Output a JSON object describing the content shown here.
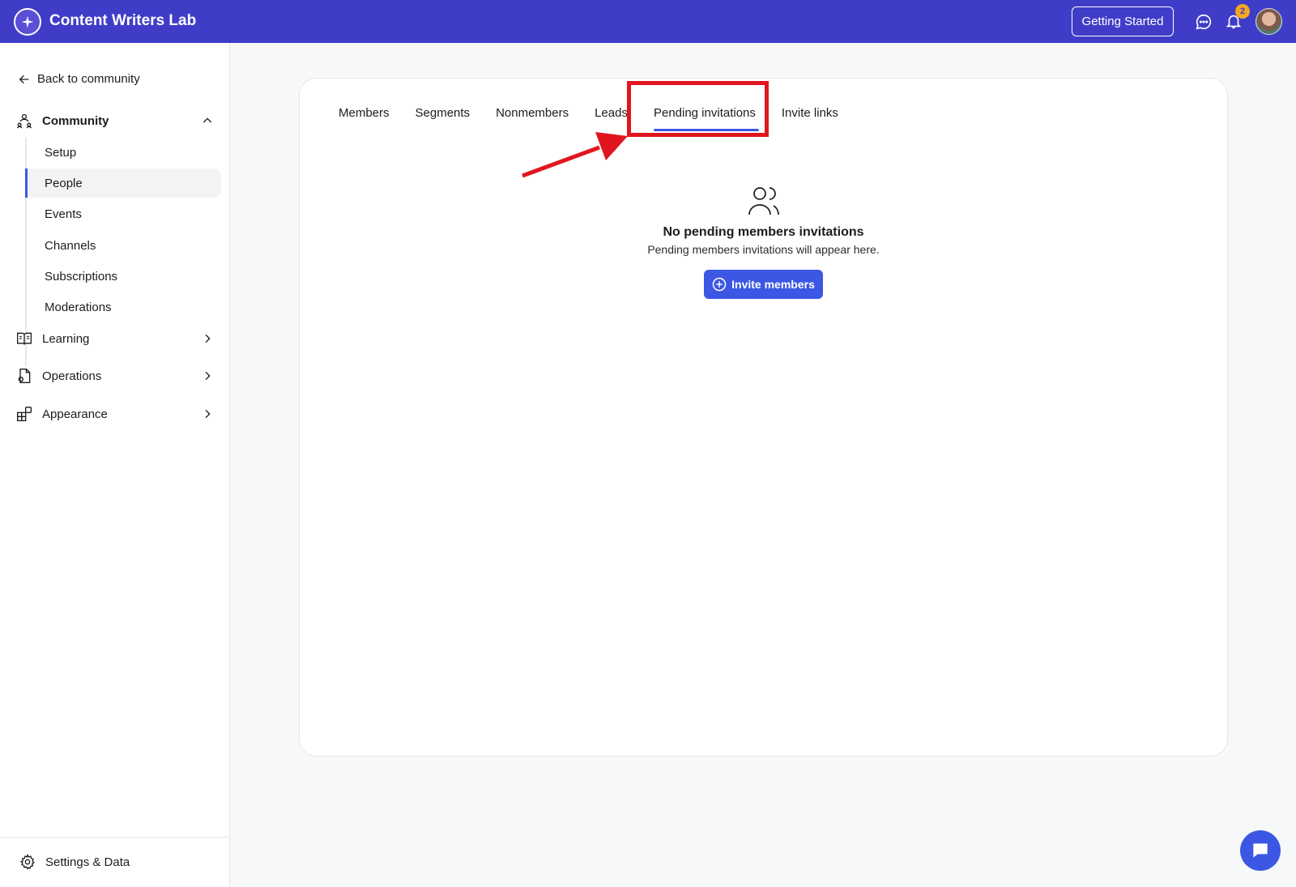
{
  "header": {
    "app_title": "Content Writers Lab",
    "getting_started_label": "Getting Started",
    "notification_count": "2",
    "brand_color": "#3f3dc8"
  },
  "sidebar": {
    "back_label": "Back to community",
    "community": {
      "label": "Community",
      "items": [
        {
          "label": "Setup"
        },
        {
          "label": "People"
        },
        {
          "label": "Events"
        },
        {
          "label": "Channels"
        },
        {
          "label": "Subscriptions"
        },
        {
          "label": "Moderations"
        }
      ]
    },
    "groups": [
      {
        "label": "Learning",
        "icon": "book-icon"
      },
      {
        "label": "Operations",
        "icon": "document-icon"
      },
      {
        "label": "Appearance",
        "icon": "layout-icon"
      }
    ],
    "settings_label": "Settings & Data"
  },
  "main": {
    "tabs": [
      {
        "label": "Members"
      },
      {
        "label": "Segments"
      },
      {
        "label": "Nonmembers"
      },
      {
        "label": "Leads"
      },
      {
        "label": "Pending invitations"
      },
      {
        "label": "Invite links"
      }
    ],
    "active_tab": "Pending invitations",
    "empty_state": {
      "title": "No pending members invitations",
      "subtitle": "Pending members invitations will appear here.",
      "button_label": "Invite members"
    },
    "accent_color": "#3b57e4",
    "annotation_color": "#e0161e"
  }
}
